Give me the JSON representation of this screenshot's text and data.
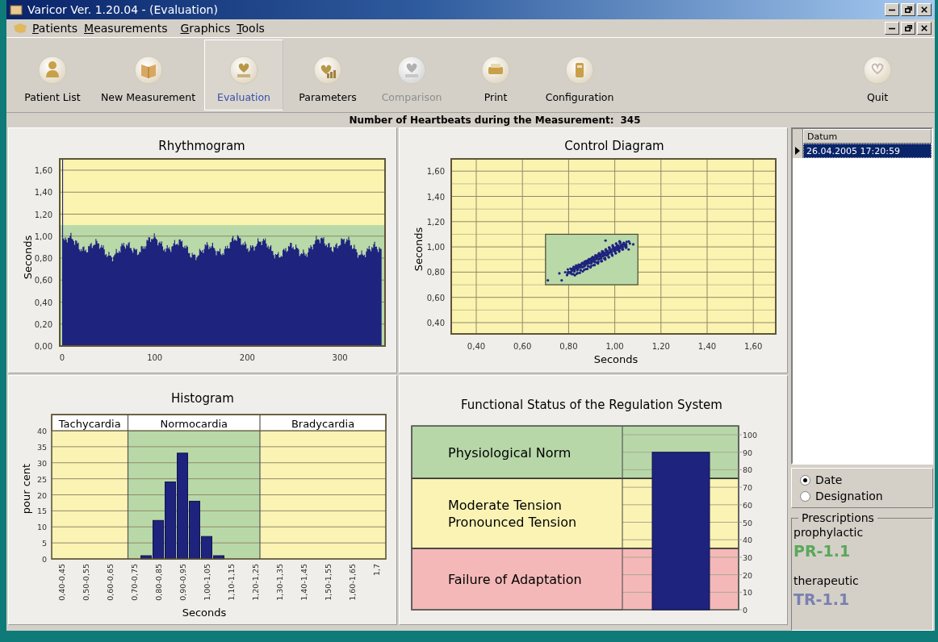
{
  "window": {
    "title": "Varicor Ver. 1.20.04 - (Evaluation)"
  },
  "menu": [
    {
      "label": "Patients"
    },
    {
      "label": "Measurements"
    },
    {
      "label": "Graphics"
    },
    {
      "label": "Tools"
    }
  ],
  "toolbar": [
    {
      "label": "Patient List",
      "selected": false,
      "disabled": false
    },
    {
      "label": "New Measurement",
      "selected": false,
      "disabled": false
    },
    {
      "label": "Evaluation",
      "selected": true,
      "disabled": false
    },
    {
      "label": "Parameters",
      "selected": false,
      "disabled": false
    },
    {
      "label": "Comparison",
      "selected": false,
      "disabled": true
    },
    {
      "label": "Print",
      "selected": false,
      "disabled": false
    },
    {
      "label": "Configuration",
      "selected": false,
      "disabled": false
    },
    {
      "label": "Quit",
      "selected": false,
      "disabled": false
    }
  ],
  "summary": {
    "label": "Number of Heartbeats during the Measurement:",
    "value": "345"
  },
  "rhythmogram": {
    "title": "Rhythmogram",
    "ylabel": "Seconds",
    "ytick_labels": [
      "1,60",
      "1,40",
      "1,20",
      "1,00",
      "0,80",
      "0,60",
      "0,40",
      "0,20",
      "0,00"
    ],
    "xtick_labels": [
      "0",
      "100",
      "200",
      "300"
    ]
  },
  "control_diagram": {
    "title": "Control Diagram",
    "ylabel": "Seconds",
    "xlabel": "Seconds",
    "ytick_labels": [
      "1,60",
      "1,40",
      "1,20",
      "1,00",
      "0,80",
      "0,60",
      "0,40"
    ],
    "xtick_labels": [
      "0,40",
      "0,60",
      "0,80",
      "1,00",
      "1,20",
      "1,40",
      "1,60"
    ]
  },
  "histogram": {
    "zones": [
      {
        "label": "Tachycardia",
        "color": "#fbf3b4"
      },
      {
        "label": "Normocardia",
        "color": "#b9d8a8"
      },
      {
        "label": "Bradycardia",
        "color": "#fbf3b4"
      }
    ],
    "chart_data": {
      "type": "bar",
      "title": "Histogram",
      "xlabel": "Seconds",
      "ylabel": "pour cent",
      "grid": true,
      "categories": [
        "0,40-0,45",
        null,
        "0,50-0,55",
        null,
        "0,60-0,65",
        null,
        "0,70-0,75",
        null,
        "0,80-0,85",
        null,
        "0,90-0,95",
        null,
        "1,00-1,05",
        null,
        "1,10-1,15",
        null,
        "1,20-1,25",
        null,
        "1,30-1,35",
        null,
        "1,40-1,45",
        null,
        "1,50-1,55",
        null,
        "1,60-1,65",
        null,
        "1,7"
      ],
      "values": [
        0,
        0,
        0,
        0,
        0,
        0,
        0,
        1,
        12,
        24,
        33,
        18,
        7,
        1,
        0,
        0,
        0,
        0,
        0,
        0,
        0,
        0,
        0,
        0,
        0,
        0,
        0
      ],
      "ylim": [
        0,
        40
      ],
      "yticks": [
        0,
        5,
        10,
        15,
        20,
        25,
        30,
        35,
        40
      ]
    }
  },
  "functional_status": {
    "chart_data": {
      "type": "bar",
      "title": "Functional Status of the Regulation System",
      "grid": true,
      "bands": [
        {
          "axis": "y",
          "from": 75,
          "to": 105,
          "label": "Physiological Norm",
          "color": "#b7d7a8"
        },
        {
          "axis": "y",
          "from": 35,
          "to": 75,
          "label": "Moderate Tension\nPronounced Tension",
          "color": "#fbf3b4"
        },
        {
          "axis": "y",
          "from": 0,
          "to": 35,
          "label": "Failure of Adaptation",
          "color": "#f5b8b8"
        }
      ],
      "values": [
        90
      ],
      "ylim": [
        0,
        105
      ],
      "yticks": [
        0,
        10,
        20,
        30,
        40,
        50,
        60,
        70,
        80,
        90,
        100
      ]
    }
  },
  "sidebar": {
    "table": {
      "columns": [
        "Datum"
      ],
      "rows": [
        {
          "cells": [
            "26.04.2005 17:20:59"
          ],
          "selected": true
        }
      ]
    },
    "sort_options": [
      {
        "label": "Date",
        "selected": true
      },
      {
        "label": "Designation",
        "selected": false
      }
    ],
    "prescriptions": {
      "title": "Prescriptions",
      "items": [
        {
          "label": "prophylactic",
          "code": "PR-1.1",
          "color": "#5aa85a"
        },
        {
          "label": "therapeutic",
          "code": "TR-1.1",
          "color": "#7a80b0"
        }
      ]
    }
  }
}
